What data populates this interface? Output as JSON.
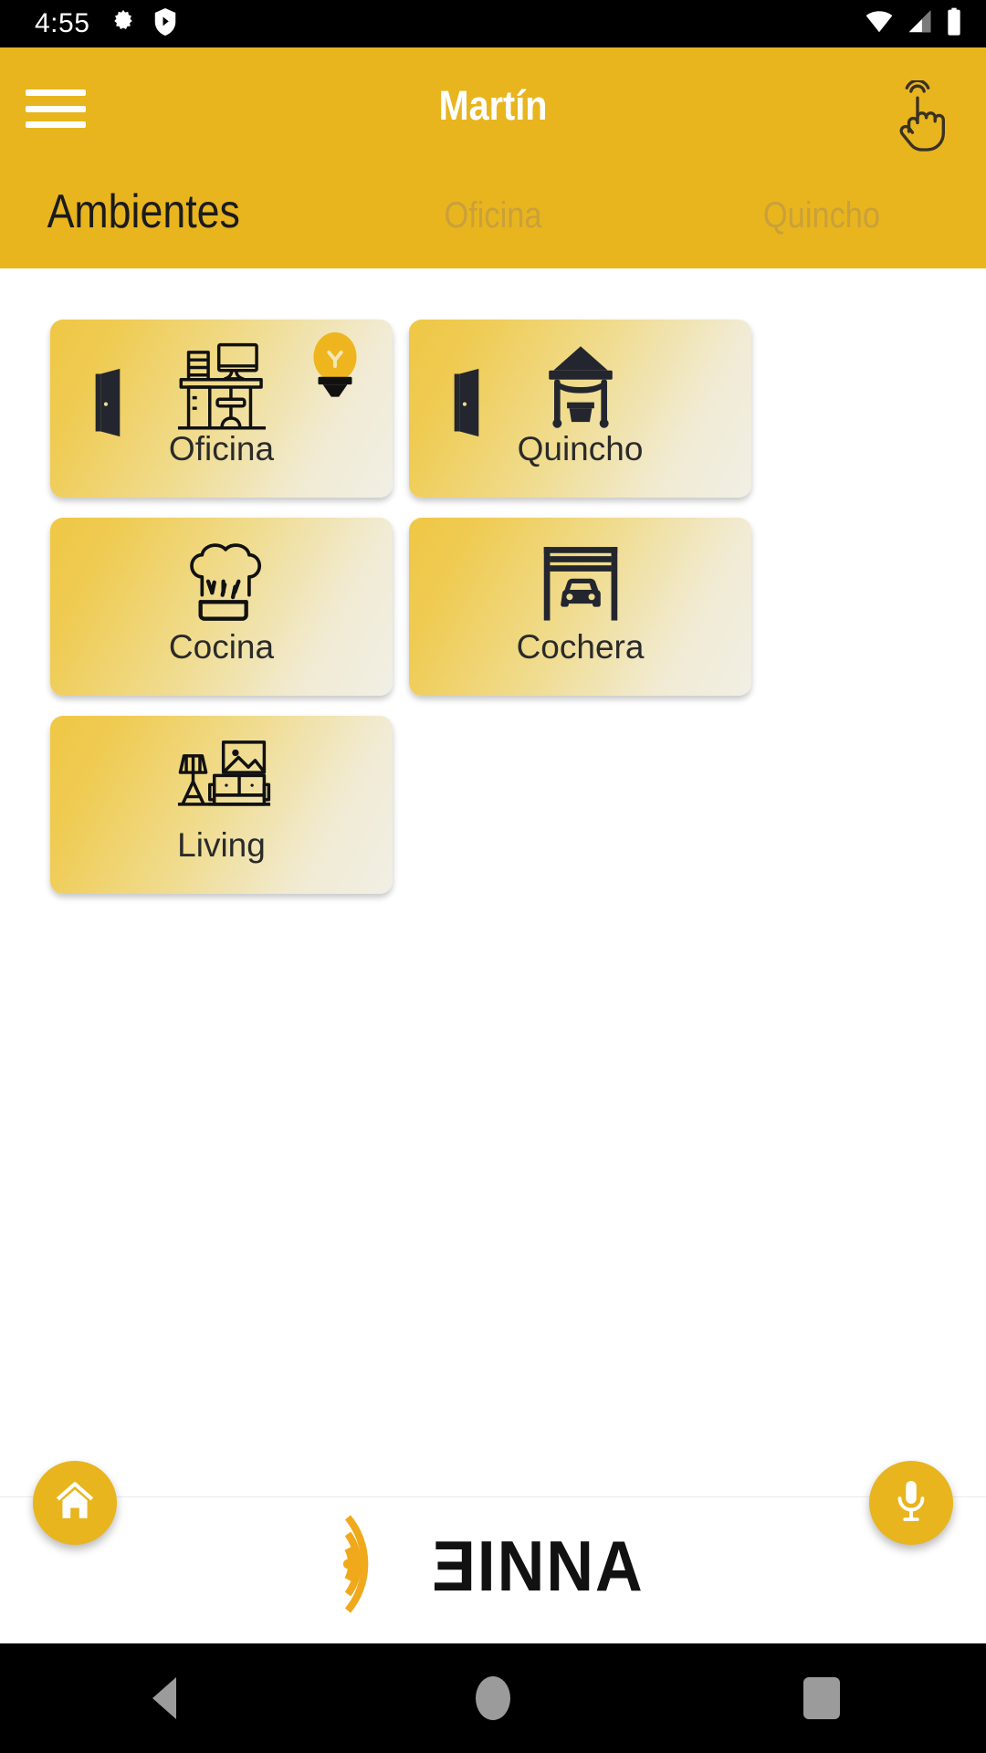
{
  "status_bar": {
    "time": "4:55",
    "left_icons": [
      "gear-icon",
      "shield-play-icon"
    ],
    "right_icons": [
      "wifi-icon",
      "cellular-signal-icon",
      "battery-icon"
    ]
  },
  "header": {
    "menu_icon": "hamburger-menu-icon",
    "title": "Martín",
    "action_icon": "tap-gesture-icon",
    "background_color": "#E8B51F"
  },
  "tabs": [
    {
      "label": "Ambientes",
      "active": true
    },
    {
      "label": "Oficina",
      "active": false
    },
    {
      "label": "Quincho",
      "active": false
    }
  ],
  "rooms": [
    {
      "label": "Oficina",
      "icon": "office-desk-icon",
      "has_door": true,
      "light_on": true
    },
    {
      "label": "Quincho",
      "icon": "gazebo-icon",
      "has_door": true,
      "light_on": false
    },
    {
      "label": "Cocina",
      "icon": "chef-hat-icon",
      "has_door": false,
      "light_on": false
    },
    {
      "label": "Cochera",
      "icon": "garage-car-icon",
      "has_door": false,
      "light_on": false
    },
    {
      "label": "Living",
      "icon": "living-sofa-icon",
      "has_door": false,
      "light_on": false
    }
  ],
  "bottom_bar": {
    "home_button": "home-icon",
    "mic_button": "microphone-icon",
    "brand_name": "ƎINNA",
    "brand_mark": "sound-waves-icon",
    "accent_color": "#E8B51F"
  },
  "android_nav": {
    "back": "back-triangle-icon",
    "home": "home-circle-icon",
    "recents": "recents-square-icon"
  }
}
